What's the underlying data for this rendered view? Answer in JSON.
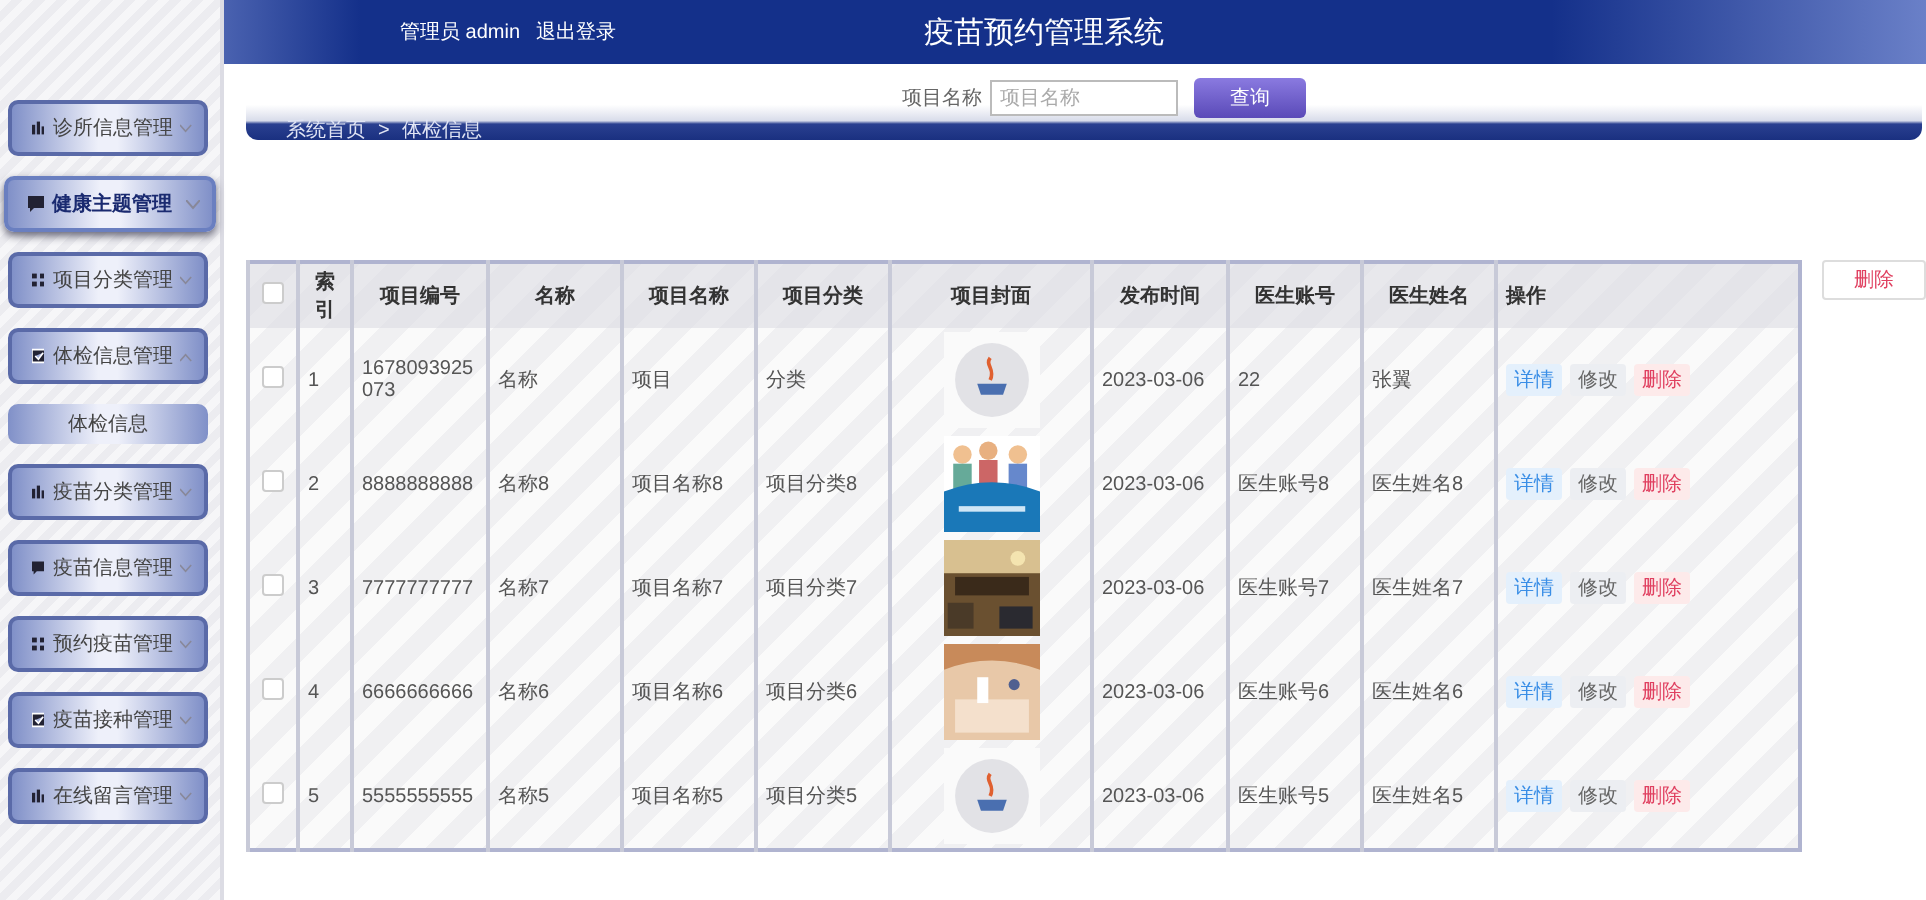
{
  "header": {
    "admin_label": "管理员 admin",
    "logout": "退出登录",
    "title": "疫苗预约管理系统"
  },
  "sidebar": {
    "items": [
      {
        "label": "诊所信息管理",
        "selected": false,
        "expanded": false
      },
      {
        "label": "健康主题管理",
        "selected": true,
        "expanded": false
      },
      {
        "label": "项目分类管理",
        "selected": false,
        "expanded": false
      },
      {
        "label": "体检信息管理",
        "selected": false,
        "expanded": true,
        "children": [
          {
            "label": "体检信息"
          }
        ]
      },
      {
        "label": "疫苗分类管理",
        "selected": false,
        "expanded": false
      },
      {
        "label": "疫苗信息管理",
        "selected": false,
        "expanded": false
      },
      {
        "label": "预约疫苗管理",
        "selected": false,
        "expanded": false
      },
      {
        "label": "疫苗接种管理",
        "selected": false,
        "expanded": false
      },
      {
        "label": "在线留言管理",
        "selected": false,
        "expanded": false
      }
    ]
  },
  "search": {
    "label": "项目名称",
    "placeholder": "项目名称",
    "button": "查询"
  },
  "breadcrumb": [
    "系统首页",
    "体检信息"
  ],
  "breadcrumb_separator": ">",
  "bulk_delete": "删除",
  "table": {
    "header_checked": false,
    "columns": [
      "索引",
      "项目编号",
      "名称",
      "项目名称",
      "项目分类",
      "项目封面",
      "发布时间",
      "医生账号",
      "医生姓名",
      "操作"
    ],
    "rows": [
      {
        "checked": false,
        "cells": [
          "1",
          "1678093925073",
          "名称",
          "项目",
          "分类",
          null,
          "2023-03-06",
          "22",
          "张翼"
        ],
        "actions": [
          "详情",
          "修改",
          "删除"
        ]
      },
      {
        "checked": false,
        "cells": [
          "2",
          "8888888888",
          "名称8",
          "项目名称8",
          "项目分类8",
          null,
          "2023-03-06",
          "医生账号8",
          "医生姓名8"
        ],
        "actions": [
          "详情",
          "修改",
          "删除"
        ]
      },
      {
        "checked": false,
        "cells": [
          "3",
          "7777777777",
          "名称7",
          "项目名称7",
          "项目分类7",
          null,
          "2023-03-06",
          "医生账号7",
          "医生姓名7"
        ],
        "actions": [
          "详情",
          "修改",
          "删除"
        ]
      },
      {
        "checked": false,
        "cells": [
          "4",
          "6666666666",
          "名称6",
          "项目名称6",
          "项目分类6",
          null,
          "2023-03-06",
          "医生账号6",
          "医生姓名6"
        ],
        "actions": [
          "详情",
          "修改",
          "删除"
        ]
      },
      {
        "checked": false,
        "cells": [
          "5",
          "5555555555",
          "名称5",
          "项目名称5",
          "项目分类5",
          null,
          "2023-03-06",
          "医生账号5",
          "医生姓名5"
        ],
        "actions": [
          "详情",
          "修改",
          "删除"
        ]
      }
    ]
  }
}
